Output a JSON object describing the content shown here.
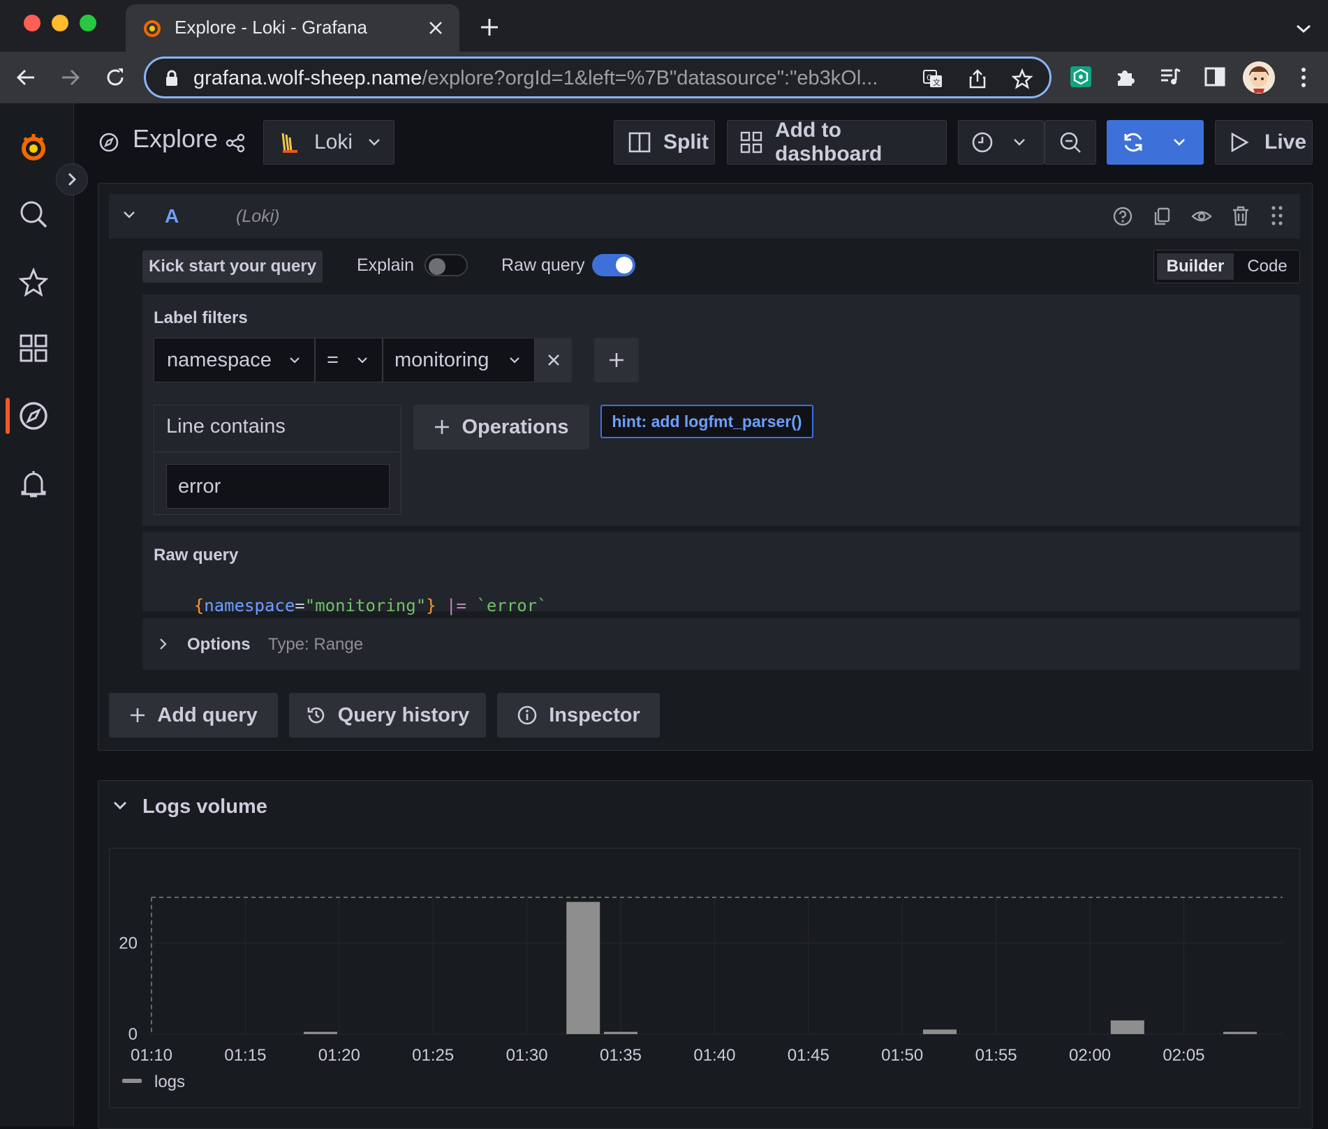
{
  "browser": {
    "tab_title": "Explore - Loki - Grafana",
    "url_host": "grafana.wolf-sheep.name",
    "url_path": "/explore?orgId=1&left=%7B\"datasource\":\"eb3kOl..."
  },
  "header": {
    "title": "Explore",
    "datasource": "Loki",
    "split_label": "Split",
    "add_to_dashboard_label": "Add to dashboard",
    "live_label": "Live"
  },
  "query": {
    "ref_id": "A",
    "datasource_hint": "(Loki)",
    "kick_start_label": "Kick start your query",
    "explain_label": "Explain",
    "explain_on": false,
    "raw_query_toggle_label": "Raw query",
    "raw_query_on": true,
    "mode_builder": "Builder",
    "mode_code": "Code",
    "label_filters_title": "Label filters",
    "filter": {
      "label": "namespace",
      "operator": "=",
      "value": "monitoring"
    },
    "line_contains_label": "Line contains",
    "line_contains_value": "error",
    "operations_label": "Operations",
    "hint": "hint: add logfmt_parser()",
    "raw_query_title": "Raw query",
    "raw": {
      "brace_open": "{",
      "key": "namespace",
      "eq": "=",
      "val": "\"monitoring\"",
      "brace_close": "}",
      "pipe": "|=",
      "line": "`error`"
    },
    "options_label": "Options",
    "options_type": "Type: Range"
  },
  "actions": {
    "add_query": "Add query",
    "query_history": "Query history",
    "inspector": "Inspector"
  },
  "logs_volume": {
    "title": "Logs volume"
  },
  "chart_data": {
    "type": "bar",
    "x_ticks": [
      "01:10",
      "01:15",
      "01:20",
      "01:25",
      "01:30",
      "01:35",
      "01:40",
      "01:45",
      "01:50",
      "01:55",
      "02:00",
      "02:05"
    ],
    "y_ticks": [
      "0",
      "20"
    ],
    "ylim": [
      0,
      30
    ],
    "series": [
      {
        "name": "logs",
        "points": [
          {
            "x": "01:19",
            "y": 0.5
          },
          {
            "x": "01:33",
            "y": 29
          },
          {
            "x": "01:35",
            "y": 0.5
          },
          {
            "x": "01:52",
            "y": 1
          },
          {
            "x": "02:02",
            "y": 3
          },
          {
            "x": "02:08",
            "y": 0.5
          }
        ]
      }
    ],
    "color": "#8e8e8e",
    "legend": "bottom-left"
  }
}
